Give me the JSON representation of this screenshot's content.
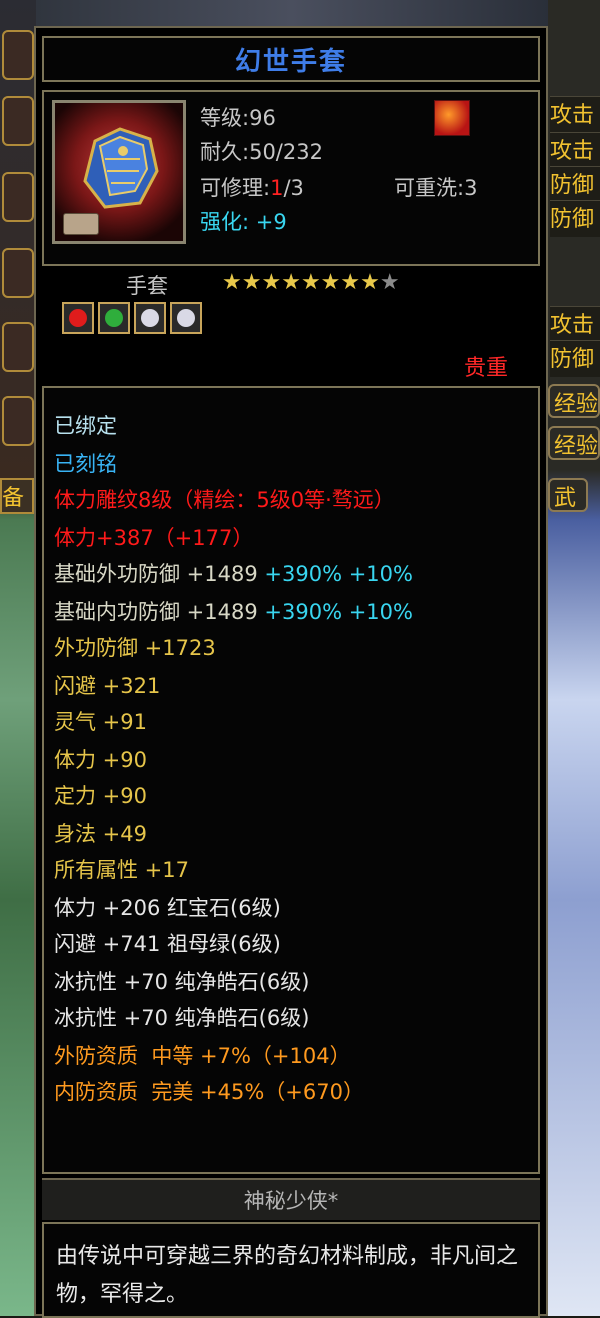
{
  "item": {
    "name": "幻世手套",
    "level_label": "等级",
    "level": "96",
    "durability_label": "耐久",
    "durability": "50/232",
    "repair_label": "可修理:",
    "repair_current": "1",
    "repair_max": "/3",
    "rewash_label": "可重洗:",
    "rewash_value": "3",
    "strengthen_label": "强化:",
    "strengthen_value": "+9",
    "type": "手套",
    "stars_filled": 8,
    "stars_total": 9,
    "rarity": "贵重",
    "gem_icons": [
      "red-gem-icon",
      "green-gem-icon",
      "white-gem-icon",
      "white-gem-icon"
    ]
  },
  "stats": {
    "bound": "已绑定",
    "engraved": "已刻铭",
    "engraving": "体力雕纹8级（精绘：5级0等·骛远）",
    "stamina_main": "体力+387（+177）",
    "base_ext_def_label": "基础外功防御 +1489",
    "base_ext_def_bonus": "+390% +10%",
    "base_int_def_label": "基础内功防御 +1489",
    "base_int_def_bonus": "+390% +10%",
    "lines": [
      "外功防御 +1723",
      "闪避 +321",
      "灵气 +91",
      "体力 +90",
      "定力 +90",
      "身法 +49",
      "所有属性 +17"
    ],
    "gems": [
      "体力 +206 红宝石(6级)",
      "闪避 +741 祖母绿(6级)",
      "冰抗性 +70 纯净皓石(6级)",
      "冰抗性 +70 纯净皓石(6级)"
    ],
    "quality": [
      "外防资质  中等 +7%（+104）",
      "内防资质  完美 +45%（+670）"
    ]
  },
  "signature": "神秘少侠*",
  "description": "由传说中可穿越三界的奇幻材料制成，非凡间之物，罕得之。",
  "side_panel": {
    "lines": [
      "攻击",
      "攻击",
      "防御",
      "防御",
      "攻击",
      "防御"
    ],
    "buttons": [
      "经验",
      "经验"
    ],
    "left_tab": "备",
    "right_tab": "武"
  }
}
